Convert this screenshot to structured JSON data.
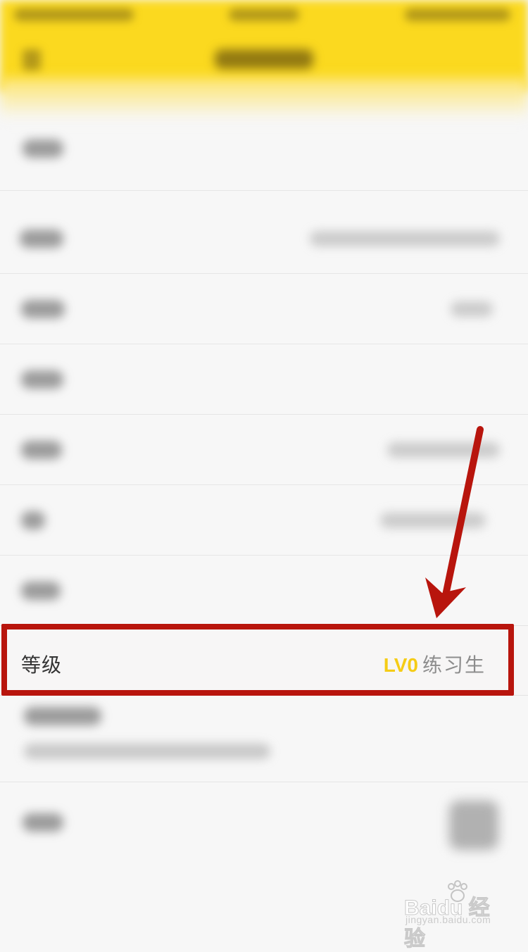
{
  "level_row": {
    "label": "等级",
    "level_code": "LV0",
    "level_title": "练习生"
  },
  "watermark": {
    "brand": "Baidu 经验",
    "url": "jingyan.baidu.com"
  },
  "colors": {
    "header_yellow": "#fbd91f",
    "level_code": "#f5cc16",
    "highlight_red": "#b8150d",
    "background": "#f7f7f7"
  }
}
